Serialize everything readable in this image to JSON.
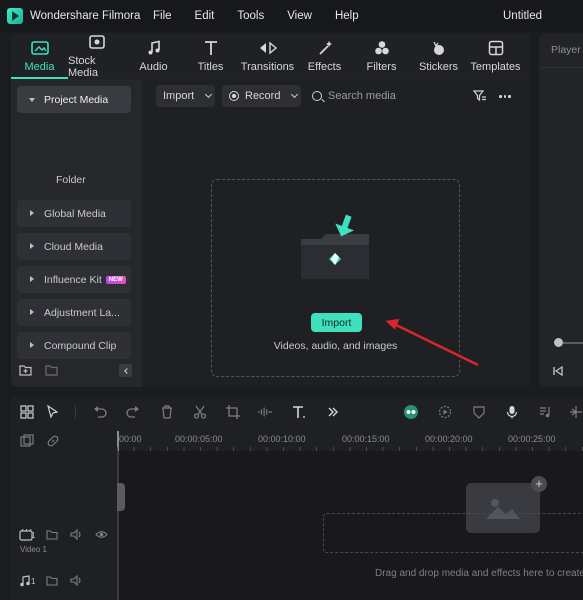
{
  "app": {
    "name": "Wondershare Filmora",
    "document_title": "Untitled"
  },
  "menu": {
    "items": [
      "File",
      "Edit",
      "Tools",
      "View",
      "Help"
    ]
  },
  "toolbar": {
    "tabs": [
      {
        "label": "Media",
        "icon": "media-icon",
        "active": true
      },
      {
        "label": "Stock Media",
        "icon": "stock-media-icon"
      },
      {
        "label": "Audio",
        "icon": "music-note-icon"
      },
      {
        "label": "Titles",
        "icon": "title-t-icon"
      },
      {
        "label": "Transitions",
        "icon": "transitions-icon"
      },
      {
        "label": "Effects",
        "icon": "sparkle-icon"
      },
      {
        "label": "Filters",
        "icon": "filters-icon"
      },
      {
        "label": "Stickers",
        "icon": "sticker-icon"
      },
      {
        "label": "Templates",
        "icon": "templates-icon"
      }
    ]
  },
  "sidebar": {
    "items": [
      {
        "label": "Project Media",
        "open": true
      },
      {
        "label": "Global Media"
      },
      {
        "label": "Cloud Media"
      },
      {
        "label": "Influence Kit",
        "badge": "NEW"
      },
      {
        "label": "Adjustment La..."
      },
      {
        "label": "Compound Clip"
      }
    ],
    "folder_label": "Folder"
  },
  "media_controls": {
    "import_label": "Import",
    "record_label": "Record",
    "search_placeholder": "Search media"
  },
  "dropzone": {
    "import_button": "Import",
    "hint": "Videos, audio, and images"
  },
  "player": {
    "label": "Player"
  },
  "timeline": {
    "ruler": [
      "00:00",
      "00:00:05:00",
      "00:00:10:00",
      "00:00:15:00",
      "00:00:20:00",
      "00:00:25:00"
    ],
    "video_track_label": "Video 1",
    "track_numbers": [
      "1",
      "1"
    ],
    "drag_hint": "Drag and drop media and effects here to create"
  },
  "colors": {
    "accent": "#41e0bd",
    "arrow": "#d8262b"
  }
}
